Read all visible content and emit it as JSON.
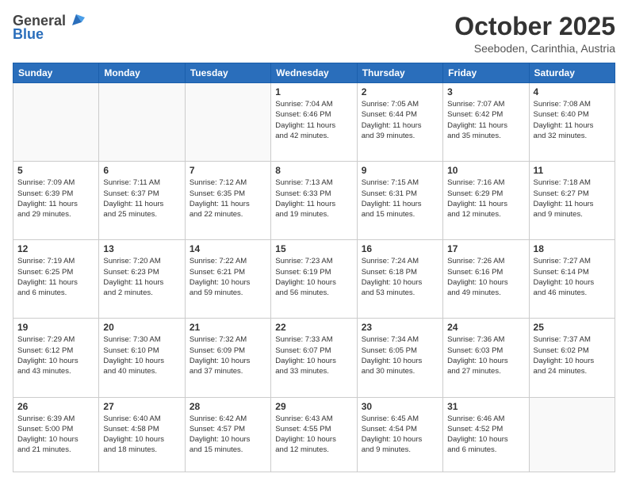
{
  "header": {
    "logo": {
      "text_general": "General",
      "text_blue": "Blue"
    },
    "title": "October 2025",
    "location": "Seeboden, Carinthia, Austria"
  },
  "calendar": {
    "days_of_week": [
      "Sunday",
      "Monday",
      "Tuesday",
      "Wednesday",
      "Thursday",
      "Friday",
      "Saturday"
    ],
    "weeks": [
      [
        {
          "day": "",
          "info": ""
        },
        {
          "day": "",
          "info": ""
        },
        {
          "day": "",
          "info": ""
        },
        {
          "day": "1",
          "info": "Sunrise: 7:04 AM\nSunset: 6:46 PM\nDaylight: 11 hours\nand 42 minutes."
        },
        {
          "day": "2",
          "info": "Sunrise: 7:05 AM\nSunset: 6:44 PM\nDaylight: 11 hours\nand 39 minutes."
        },
        {
          "day": "3",
          "info": "Sunrise: 7:07 AM\nSunset: 6:42 PM\nDaylight: 11 hours\nand 35 minutes."
        },
        {
          "day": "4",
          "info": "Sunrise: 7:08 AM\nSunset: 6:40 PM\nDaylight: 11 hours\nand 32 minutes."
        }
      ],
      [
        {
          "day": "5",
          "info": "Sunrise: 7:09 AM\nSunset: 6:39 PM\nDaylight: 11 hours\nand 29 minutes."
        },
        {
          "day": "6",
          "info": "Sunrise: 7:11 AM\nSunset: 6:37 PM\nDaylight: 11 hours\nand 25 minutes."
        },
        {
          "day": "7",
          "info": "Sunrise: 7:12 AM\nSunset: 6:35 PM\nDaylight: 11 hours\nand 22 minutes."
        },
        {
          "day": "8",
          "info": "Sunrise: 7:13 AM\nSunset: 6:33 PM\nDaylight: 11 hours\nand 19 minutes."
        },
        {
          "day": "9",
          "info": "Sunrise: 7:15 AM\nSunset: 6:31 PM\nDaylight: 11 hours\nand 15 minutes."
        },
        {
          "day": "10",
          "info": "Sunrise: 7:16 AM\nSunset: 6:29 PM\nDaylight: 11 hours\nand 12 minutes."
        },
        {
          "day": "11",
          "info": "Sunrise: 7:18 AM\nSunset: 6:27 PM\nDaylight: 11 hours\nand 9 minutes."
        }
      ],
      [
        {
          "day": "12",
          "info": "Sunrise: 7:19 AM\nSunset: 6:25 PM\nDaylight: 11 hours\nand 6 minutes."
        },
        {
          "day": "13",
          "info": "Sunrise: 7:20 AM\nSunset: 6:23 PM\nDaylight: 11 hours\nand 2 minutes."
        },
        {
          "day": "14",
          "info": "Sunrise: 7:22 AM\nSunset: 6:21 PM\nDaylight: 10 hours\nand 59 minutes."
        },
        {
          "day": "15",
          "info": "Sunrise: 7:23 AM\nSunset: 6:19 PM\nDaylight: 10 hours\nand 56 minutes."
        },
        {
          "day": "16",
          "info": "Sunrise: 7:24 AM\nSunset: 6:18 PM\nDaylight: 10 hours\nand 53 minutes."
        },
        {
          "day": "17",
          "info": "Sunrise: 7:26 AM\nSunset: 6:16 PM\nDaylight: 10 hours\nand 49 minutes."
        },
        {
          "day": "18",
          "info": "Sunrise: 7:27 AM\nSunset: 6:14 PM\nDaylight: 10 hours\nand 46 minutes."
        }
      ],
      [
        {
          "day": "19",
          "info": "Sunrise: 7:29 AM\nSunset: 6:12 PM\nDaylight: 10 hours\nand 43 minutes."
        },
        {
          "day": "20",
          "info": "Sunrise: 7:30 AM\nSunset: 6:10 PM\nDaylight: 10 hours\nand 40 minutes."
        },
        {
          "day": "21",
          "info": "Sunrise: 7:32 AM\nSunset: 6:09 PM\nDaylight: 10 hours\nand 37 minutes."
        },
        {
          "day": "22",
          "info": "Sunrise: 7:33 AM\nSunset: 6:07 PM\nDaylight: 10 hours\nand 33 minutes."
        },
        {
          "day": "23",
          "info": "Sunrise: 7:34 AM\nSunset: 6:05 PM\nDaylight: 10 hours\nand 30 minutes."
        },
        {
          "day": "24",
          "info": "Sunrise: 7:36 AM\nSunset: 6:03 PM\nDaylight: 10 hours\nand 27 minutes."
        },
        {
          "day": "25",
          "info": "Sunrise: 7:37 AM\nSunset: 6:02 PM\nDaylight: 10 hours\nand 24 minutes."
        }
      ],
      [
        {
          "day": "26",
          "info": "Sunrise: 6:39 AM\nSunset: 5:00 PM\nDaylight: 10 hours\nand 21 minutes."
        },
        {
          "day": "27",
          "info": "Sunrise: 6:40 AM\nSunset: 4:58 PM\nDaylight: 10 hours\nand 18 minutes."
        },
        {
          "day": "28",
          "info": "Sunrise: 6:42 AM\nSunset: 4:57 PM\nDaylight: 10 hours\nand 15 minutes."
        },
        {
          "day": "29",
          "info": "Sunrise: 6:43 AM\nSunset: 4:55 PM\nDaylight: 10 hours\nand 12 minutes."
        },
        {
          "day": "30",
          "info": "Sunrise: 6:45 AM\nSunset: 4:54 PM\nDaylight: 10 hours\nand 9 minutes."
        },
        {
          "day": "31",
          "info": "Sunrise: 6:46 AM\nSunset: 4:52 PM\nDaylight: 10 hours\nand 6 minutes."
        },
        {
          "day": "",
          "info": ""
        }
      ]
    ]
  }
}
